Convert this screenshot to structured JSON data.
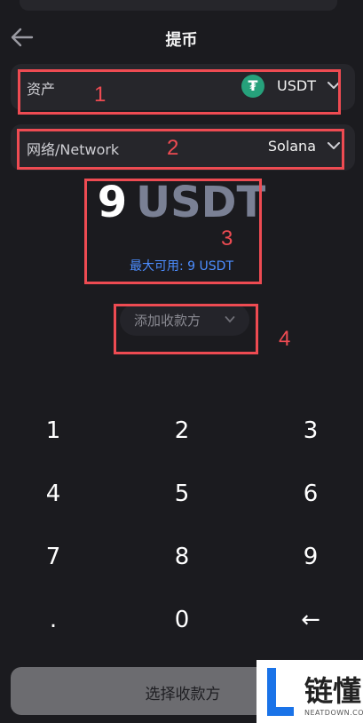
{
  "header": {
    "title": "提币"
  },
  "asset": {
    "label": "资产",
    "value": "USDT"
  },
  "network": {
    "label": "网络/Network",
    "value": "Solana"
  },
  "amount": {
    "value": "9",
    "unit": "USDT",
    "max_available": "最大可用: 9 USDT"
  },
  "payee": {
    "label": "添加收款方"
  },
  "keypad": {
    "keys": [
      "1",
      "2",
      "3",
      "4",
      "5",
      "6",
      "7",
      "8",
      "9",
      ".",
      "0",
      "←"
    ]
  },
  "action": {
    "label": "选择收款方"
  },
  "annotations": [
    "1",
    "2",
    "3",
    "4"
  ],
  "watermark": {
    "text": "链懂",
    "sub": "NEATDOWN.COM"
  },
  "colors": {
    "accent_blue": "#4c8dff",
    "tether_green": "#26a17b",
    "annotation_red": "#ee4b52"
  }
}
